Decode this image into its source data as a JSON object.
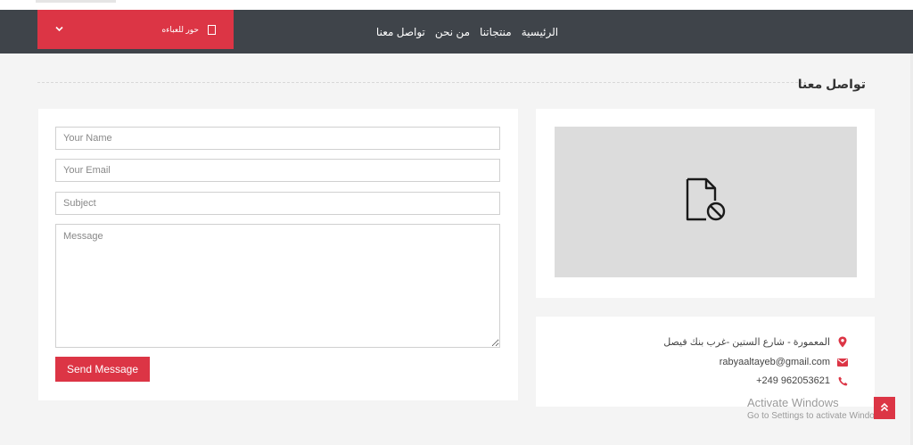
{
  "header": {
    "brand": {
      "label": "حور للعباءه"
    },
    "menu": [
      "الرئيسية",
      "منتجاتنا",
      "من نحن",
      "تواصل معنا"
    ]
  },
  "page": {
    "title": "تواصل معنا"
  },
  "form": {
    "name_placeholder": "Your Name",
    "email_placeholder": "Your Email",
    "subject_placeholder": "Subject",
    "message_placeholder": "Message",
    "send_label": "Send Message"
  },
  "map": {
    "icon": "broken-document-icon"
  },
  "contact": {
    "address": "المعمورة - شارع الستين -غرب بنك فيصل",
    "email": "rabyaaltayeb@gmail.com",
    "phone": "+249 962053621"
  },
  "watermark": {
    "line1": "Activate Windows",
    "line2": "Go to Settings to activate Windows."
  },
  "colors": {
    "accent": "#dc3545",
    "navbar": "#3f444a",
    "background": "#f4f4f4"
  }
}
